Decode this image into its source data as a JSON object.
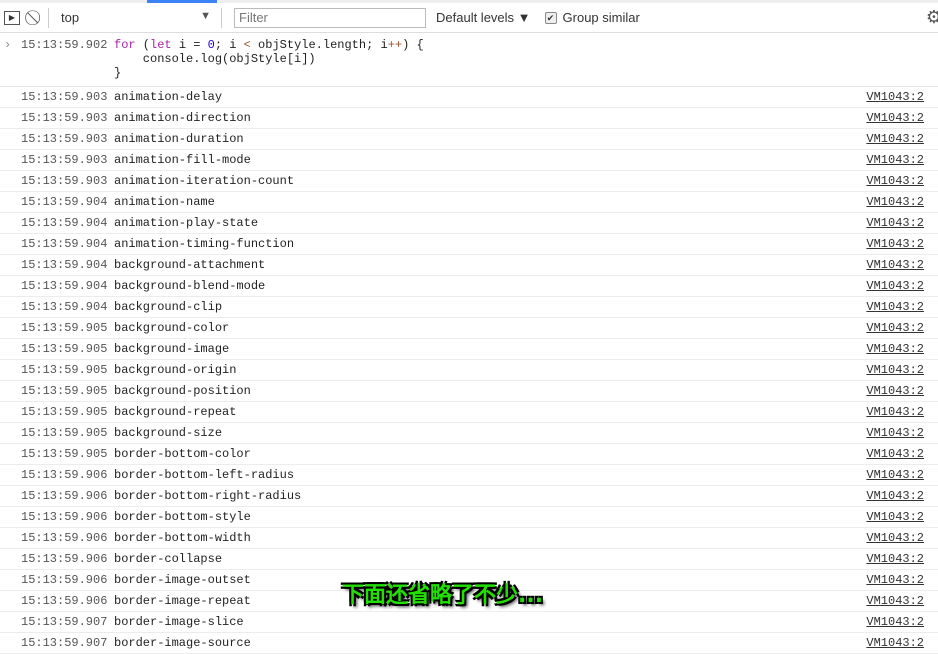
{
  "toolbar": {
    "context": "top",
    "filter_placeholder": "Filter",
    "levels": "Default levels ▼",
    "group_similar": "Group similar",
    "group_checked": true
  },
  "input": {
    "timestamp": "15:13:59.902",
    "code_lines": [
      "for (let i = 0; i < objStyle.length; i++) {",
      "    console.log(objStyle[i])",
      "}"
    ]
  },
  "rows": [
    [
      "15:13:59.903",
      "animation-delay"
    ],
    [
      "15:13:59.903",
      "animation-direction"
    ],
    [
      "15:13:59.903",
      "animation-duration"
    ],
    [
      "15:13:59.903",
      "animation-fill-mode"
    ],
    [
      "15:13:59.903",
      "animation-iteration-count"
    ],
    [
      "15:13:59.904",
      "animation-name"
    ],
    [
      "15:13:59.904",
      "animation-play-state"
    ],
    [
      "15:13:59.904",
      "animation-timing-function"
    ],
    [
      "15:13:59.904",
      "background-attachment"
    ],
    [
      "15:13:59.904",
      "background-blend-mode"
    ],
    [
      "15:13:59.904",
      "background-clip"
    ],
    [
      "15:13:59.905",
      "background-color"
    ],
    [
      "15:13:59.905",
      "background-image"
    ],
    [
      "15:13:59.905",
      "background-origin"
    ],
    [
      "15:13:59.905",
      "background-position"
    ],
    [
      "15:13:59.905",
      "background-repeat"
    ],
    [
      "15:13:59.905",
      "background-size"
    ],
    [
      "15:13:59.905",
      "border-bottom-color"
    ],
    [
      "15:13:59.906",
      "border-bottom-left-radius"
    ],
    [
      "15:13:59.906",
      "border-bottom-right-radius"
    ],
    [
      "15:13:59.906",
      "border-bottom-style"
    ],
    [
      "15:13:59.906",
      "border-bottom-width"
    ],
    [
      "15:13:59.906",
      "border-collapse"
    ],
    [
      "15:13:59.906",
      "border-image-outset"
    ],
    [
      "15:13:59.906",
      "border-image-repeat"
    ],
    [
      "15:13:59.907",
      "border-image-slice"
    ],
    [
      "15:13:59.907",
      "border-image-source"
    ]
  ],
  "source": "VM1043:2",
  "overlay_caption": "下面还省略了不少..."
}
